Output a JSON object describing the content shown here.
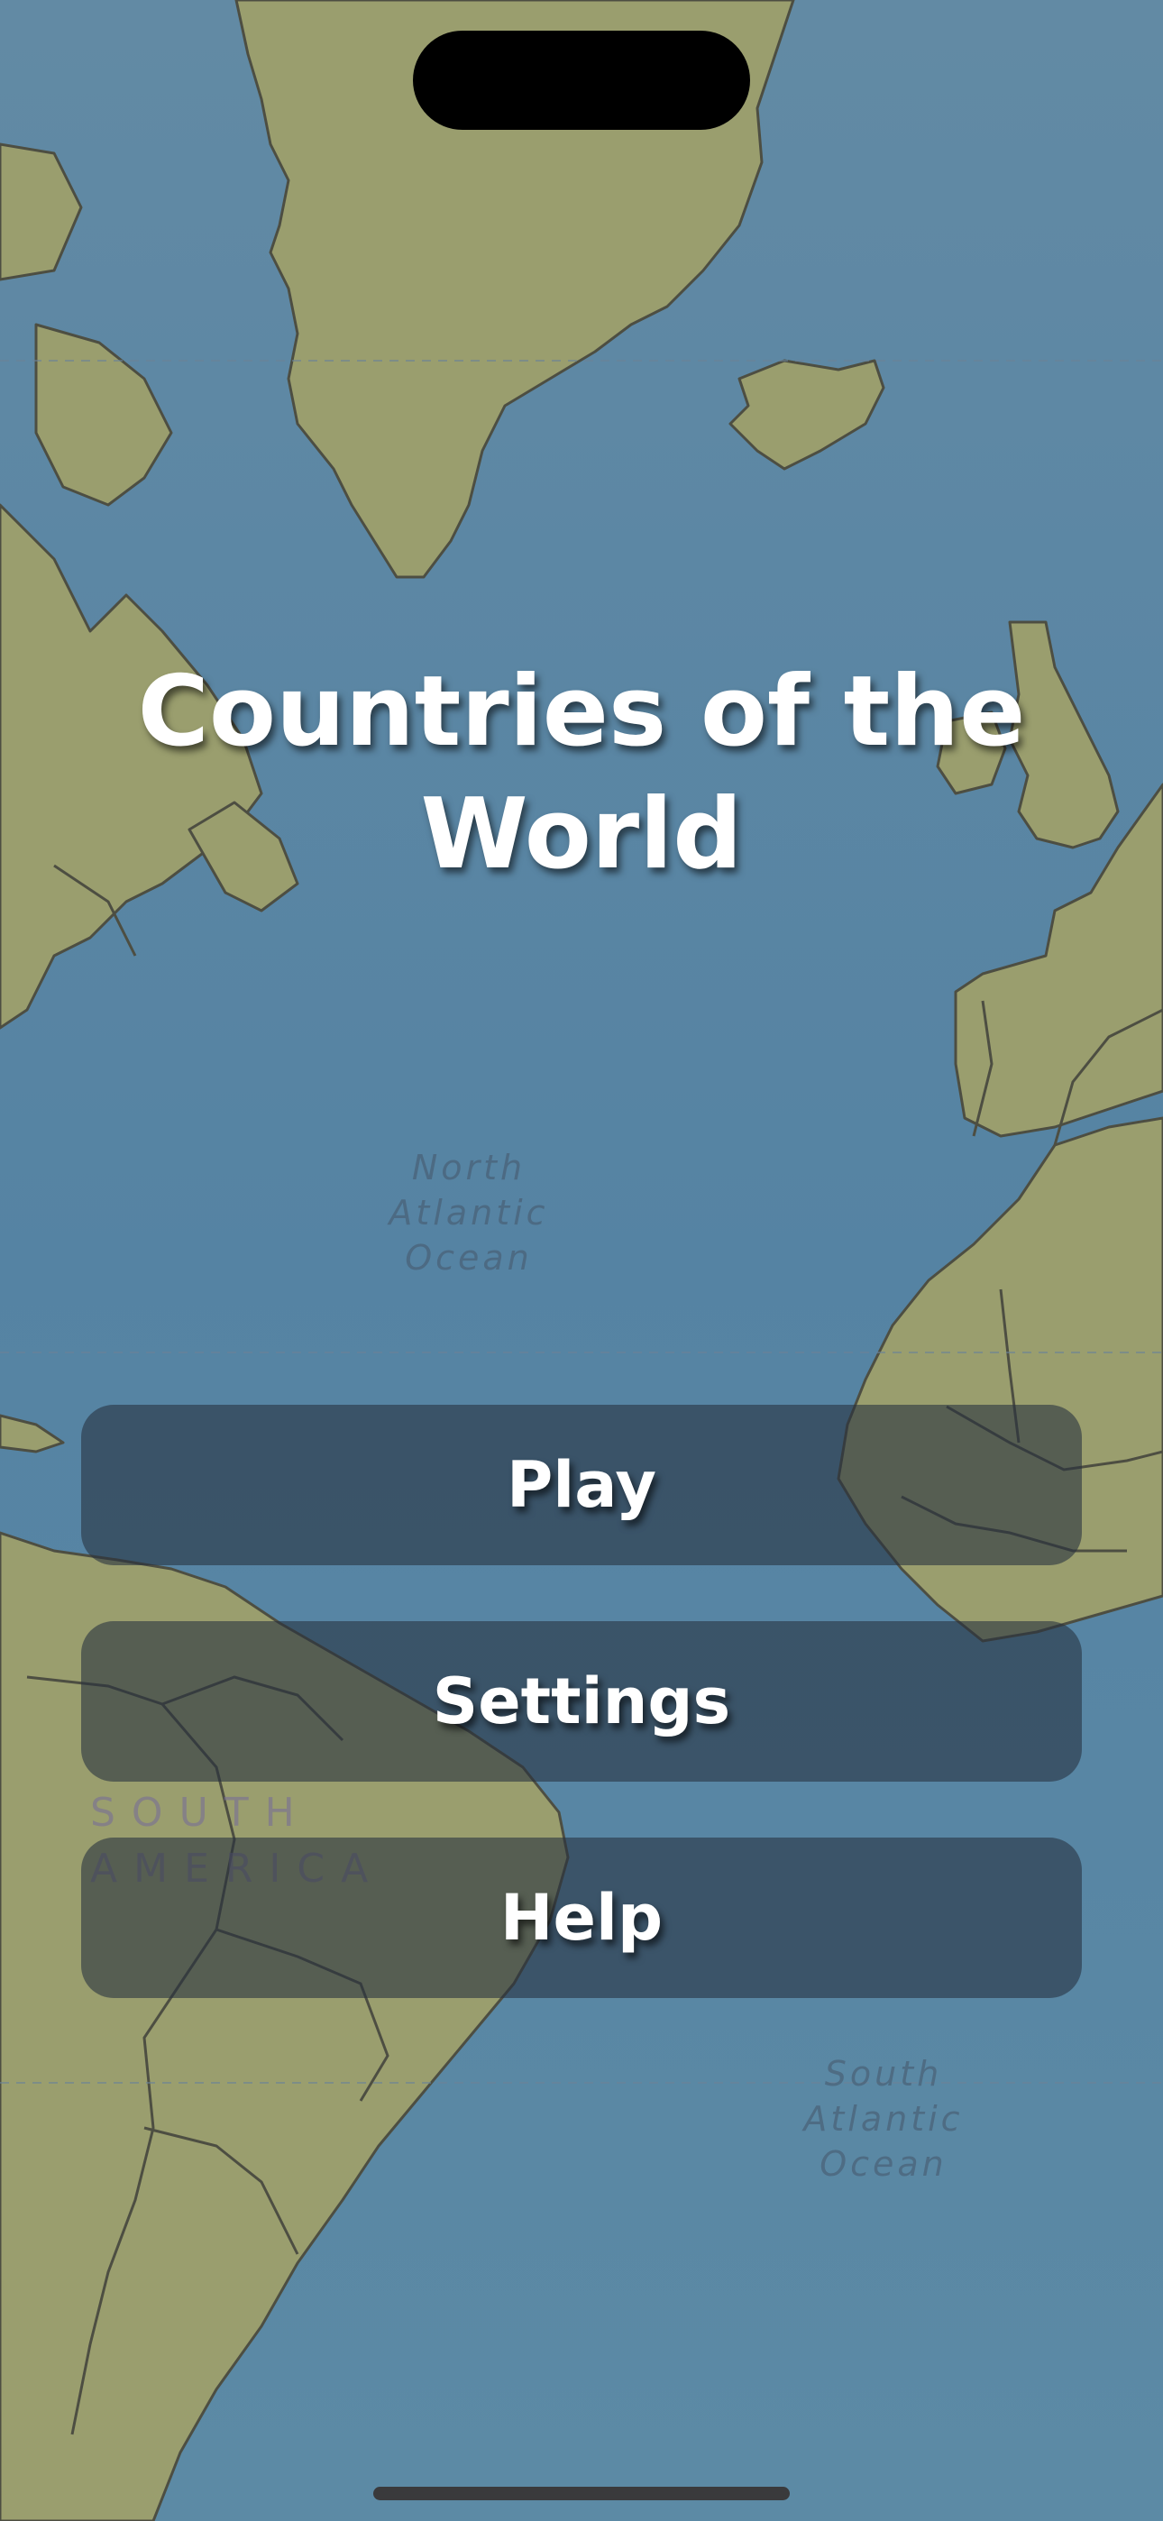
{
  "app": {
    "title": "Countries of the World"
  },
  "menu": {
    "play_label": "Play",
    "settings_label": "Settings",
    "help_label": "Help"
  },
  "map_labels": {
    "north_atlantic": "North\nAtlantic\nOcean",
    "south_atlantic": "South\nAtlantic\nOcean",
    "south_america": "SOUTH\nAMERICA"
  },
  "colors": {
    "ocean": "#5a86a3",
    "land": "#9a9e6e",
    "border": "#4a4a40",
    "button_fill": "rgba(38,48,62,0.58)",
    "text": "#ffffff"
  }
}
